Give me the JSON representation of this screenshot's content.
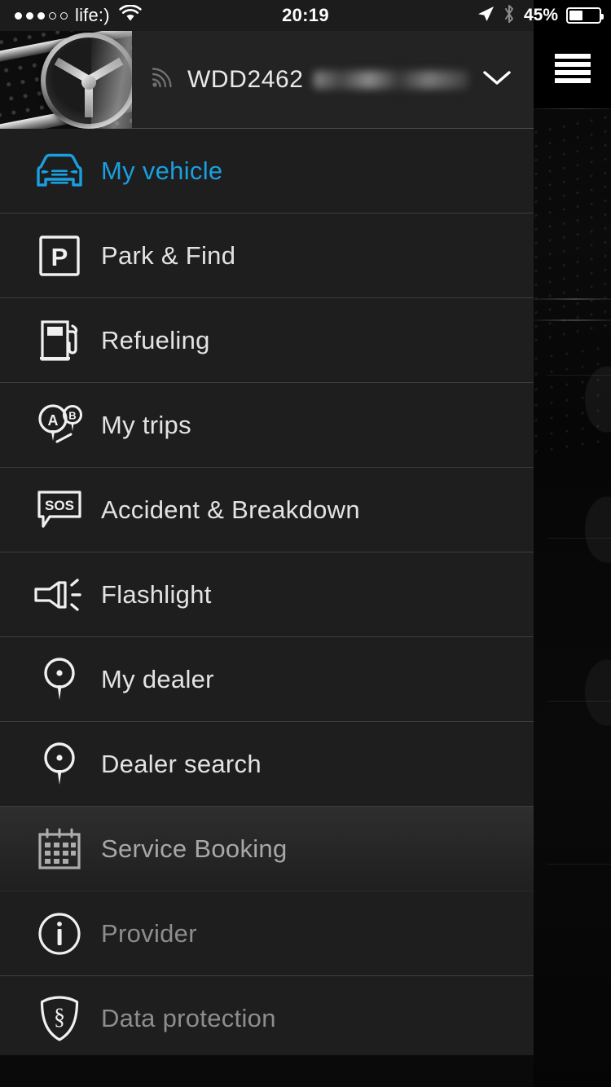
{
  "statusbar": {
    "carrier": "life:)",
    "time": "20:19",
    "battery_percent": "45%",
    "signal_dots_filled": 3,
    "signal_dots_total": 5,
    "icons": [
      "wifi-icon",
      "location-arrow-icon",
      "bluetooth-icon",
      "battery-icon"
    ]
  },
  "header": {
    "vehicle_id": "WDD2462",
    "vehicle_id_redacted": true,
    "connection_icon": "signal-arcs-icon",
    "expand_icon": "chevron-down-icon",
    "thumbnail_alt": "mercedes-benz-star-grille"
  },
  "menu": {
    "items": [
      {
        "label": "My vehicle",
        "icon": "car-front-icon",
        "state": "active"
      },
      {
        "label": "Park & Find",
        "icon": "parking-p-icon",
        "state": "normal"
      },
      {
        "label": "Refueling",
        "icon": "fuel-pump-icon",
        "state": "normal"
      },
      {
        "label": "My trips",
        "icon": "route-ab-pins-icon",
        "state": "normal"
      },
      {
        "label": "Accident & Breakdown",
        "icon": "sos-bubble-icon",
        "state": "normal"
      },
      {
        "label": "Flashlight",
        "icon": "flashlight-icon",
        "state": "normal"
      },
      {
        "label": "My dealer",
        "icon": "map-pin-icon",
        "state": "normal"
      },
      {
        "label": "Dealer search",
        "icon": "map-pin-icon",
        "state": "normal"
      },
      {
        "label": "Service Booking",
        "icon": "calendar-icon",
        "state": "pressed"
      },
      {
        "label": "Provider",
        "icon": "info-circle-icon",
        "state": "dim"
      },
      {
        "label": "Data protection",
        "icon": "shield-section-icon",
        "state": "dim"
      }
    ]
  },
  "overlay": {
    "menu_button_icon": "hamburger-menu-icon"
  },
  "colors": {
    "accent": "#1a9fe0",
    "drawer_bg": "#1e1e1e",
    "header_bg": "#232323",
    "text": "#e3e3e3",
    "text_dim": "#8d8d8d",
    "divider": "#3d3d3d"
  }
}
